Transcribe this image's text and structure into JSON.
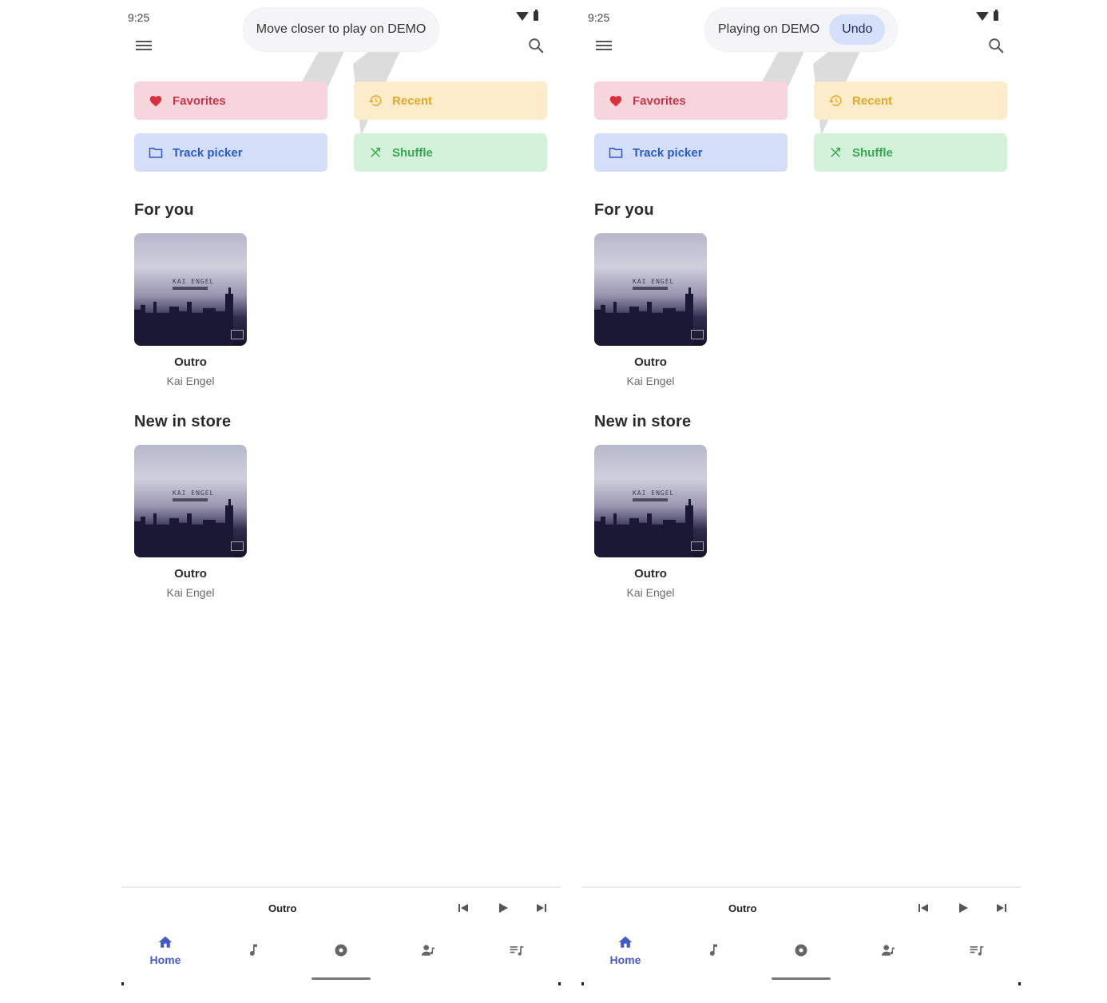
{
  "screens": [
    {
      "id": "left",
      "status": {
        "time": "9:25"
      },
      "toast": {
        "message": "Move closer to play on DEMO",
        "action": null
      },
      "shortcuts": [
        {
          "label": "Favorites",
          "icon": "heart-icon",
          "color": "#c8354a",
          "bg": "#f7d5dd"
        },
        {
          "label": "Recent",
          "icon": "history-icon",
          "color": "#e2a72e",
          "bg": "#fcecc9"
        },
        {
          "label": "Track picker",
          "icon": "folder-icon",
          "color": "#2a5bc6",
          "bg": "#d5def9"
        },
        {
          "label": "Shuffle",
          "icon": "shuffle-icon",
          "color": "#3da654",
          "bg": "#d4f1da"
        }
      ],
      "sections": [
        {
          "title": "For you",
          "items": [
            {
              "title": "Outro",
              "artist": "Kai Engel",
              "cover_text": "KAI ENGEL"
            }
          ]
        },
        {
          "title": "New in store",
          "items": [
            {
              "title": "Outro",
              "artist": "Kai Engel",
              "cover_text": "KAI ENGEL"
            }
          ]
        }
      ],
      "mini_player": {
        "title": "Outro"
      },
      "nav": [
        {
          "label": "Home",
          "icon": "home-icon",
          "active": true
        },
        {
          "label": "",
          "icon": "music-note-icon",
          "active": false
        },
        {
          "label": "",
          "icon": "album-icon",
          "active": false
        },
        {
          "label": "",
          "icon": "artist-icon",
          "active": false
        },
        {
          "label": "",
          "icon": "playlist-icon",
          "active": false
        }
      ]
    },
    {
      "id": "right",
      "status": {
        "time": "9:25"
      },
      "toast": {
        "message": "Playing on DEMO",
        "action": "Undo"
      },
      "shortcuts": [
        {
          "label": "Favorites",
          "icon": "heart-icon",
          "color": "#c8354a",
          "bg": "#f7d5dd"
        },
        {
          "label": "Recent",
          "icon": "history-icon",
          "color": "#e2a72e",
          "bg": "#fcecc9"
        },
        {
          "label": "Track picker",
          "icon": "folder-icon",
          "color": "#2a5bc6",
          "bg": "#d5def9"
        },
        {
          "label": "Shuffle",
          "icon": "shuffle-icon",
          "color": "#3da654",
          "bg": "#d4f1da"
        }
      ],
      "sections": [
        {
          "title": "For you",
          "items": [
            {
              "title": "Outro",
              "artist": "Kai Engel",
              "cover_text": "KAI ENGEL"
            }
          ]
        },
        {
          "title": "New in store",
          "items": [
            {
              "title": "Outro",
              "artist": "Kai Engel",
              "cover_text": "KAI ENGEL"
            }
          ]
        }
      ],
      "mini_player": {
        "title": "Outro"
      },
      "nav": [
        {
          "label": "Home",
          "icon": "home-icon",
          "active": true
        },
        {
          "label": "",
          "icon": "music-note-icon",
          "active": false
        },
        {
          "label": "",
          "icon": "album-icon",
          "active": false
        },
        {
          "label": "",
          "icon": "artist-icon",
          "active": false
        },
        {
          "label": "",
          "icon": "playlist-icon",
          "active": false
        }
      ]
    }
  ],
  "colors": {
    "accent": "#4759c4",
    "undo_bg": "#d6e0fb"
  }
}
